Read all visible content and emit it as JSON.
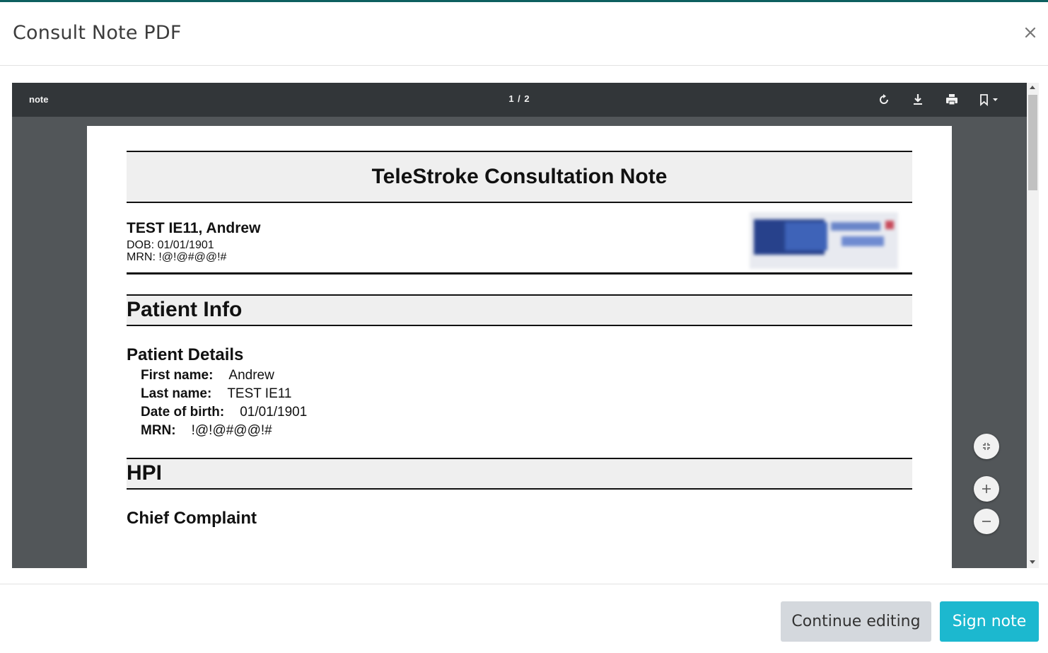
{
  "modal": {
    "title": "Consult Note PDF",
    "close_icon": "close-icon"
  },
  "viewer": {
    "doc_name": "note",
    "page_counter": "1 / 2",
    "toolbar_icons": [
      "rotate-icon",
      "download-icon",
      "print-icon",
      "bookmark-icon"
    ],
    "float_icons": [
      "fit-page-icon",
      "zoom-in-icon",
      "zoom-out-icon"
    ]
  },
  "document": {
    "title": "TeleStroke Consultation Note",
    "patient_name": "TEST IE11, Andrew",
    "dob_line": "DOB: 01/01/1901",
    "mrn_line": "MRN: !@!@#@@!#",
    "sections": {
      "patient_info": "Patient Info",
      "patient_details": "Patient Details",
      "hpi": "HPI",
      "chief_complaint": "Chief Complaint"
    },
    "details": [
      {
        "label": "First name:",
        "value": "Andrew"
      },
      {
        "label": "Last name:",
        "value": "TEST IE11"
      },
      {
        "label": "Date of birth:",
        "value": "01/01/1901"
      },
      {
        "label": "MRN:",
        "value": "!@!@#@@!#"
      }
    ]
  },
  "footer": {
    "continue_label": "Continue editing",
    "sign_label": "Sign note"
  },
  "colors": {
    "sign_button": "#1cb8cf",
    "continue_button": "#d4d8dd",
    "viewer_toolbar": "#323639",
    "viewer_background": "#525659"
  }
}
